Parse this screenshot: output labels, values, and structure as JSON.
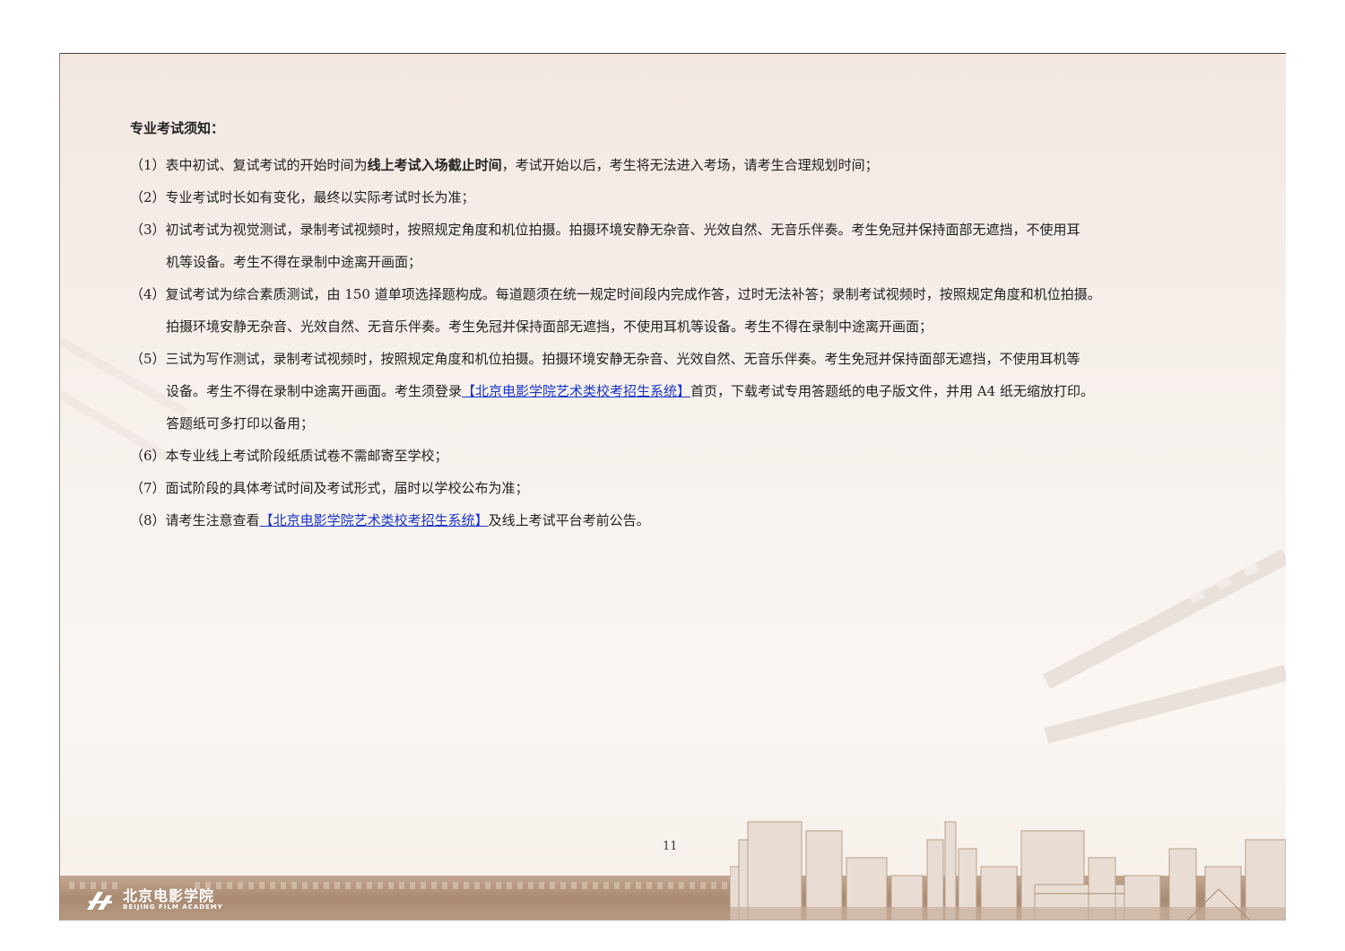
{
  "heading": "专业考试须知：",
  "items": [
    {
      "num": "（1）",
      "text_before": "表中初试、复试考试的开始时间为",
      "bold": "线上考试入场截止时间",
      "text_after": "，考试开始以后，考生将无法进入考场，请考生合理规划时间；"
    },
    {
      "num": "（2）",
      "text": "专业考试时长如有变化，最终以实际考试时长为准；"
    },
    {
      "num": "（3）",
      "line1": "初试考试为视觉测试，录制考试视频时，按照规定角度和机位拍摄。拍摄环境安静无杂音、光效自然、无音乐伴奏。考生免冠并保持面部无遮挡，不使用耳",
      "line2": "机等设备。考生不得在录制中途离开画面；"
    },
    {
      "num": "（4）",
      "line1": "复试考试为综合素质测试，由 150 道单项选择题构成。每道题须在统一规定时间段内完成作答，过时无法补答；录制考试视频时，按照规定角度和机位拍摄。",
      "line2": "拍摄环境安静无杂音、光效自然、无音乐伴奏。考生免冠并保持面部无遮挡，不使用耳机等设备。考生不得在录制中途离开画面；"
    },
    {
      "num": "（5）",
      "line1": "三试为写作测试，录制考试视频时，按照规定角度和机位拍摄。拍摄环境安静无杂音、光效自然、无音乐伴奏。考生免冠并保持面部无遮挡，不使用耳机等",
      "line2_before": "设备。考生不得在录制中途离开画面。考生须登录",
      "link": "【北京电影学院艺术类校考招生系统】",
      "line2_after": "首页，下载考试专用答题纸的电子版文件，并用 A4 纸无缩放打印。",
      "line3": "答题纸可多打印以备用；"
    },
    {
      "num": "（6）",
      "text": "本专业线上考试阶段纸质试卷不需邮寄至学校；"
    },
    {
      "num": "（7）",
      "text": "面试阶段的具体考试时间及考试形式，届时以学校公布为准；"
    },
    {
      "num": "（8）",
      "text_before": "请考生注意查看",
      "link": "【北京电影学院艺术类校考招生系统】",
      "text_after": "及线上考试平台考前公告。"
    }
  ],
  "page_number": "11",
  "logo": {
    "cn": "北京电影学院",
    "en": "BEIJING FILM ACADEMY"
  },
  "colors": {
    "link": "#1a35c9",
    "band": "#a98a72",
    "background": "#f7f1ec"
  }
}
